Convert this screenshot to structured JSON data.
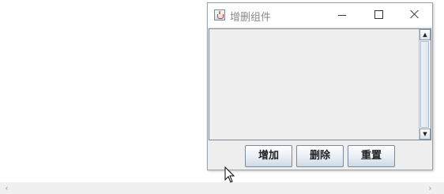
{
  "window": {
    "title": "增删组件",
    "icon": "java-cup-icon"
  },
  "buttons": {
    "add": "增加",
    "delete": "删除",
    "reset": "重置"
  },
  "scrollbar": {
    "up_glyph": "▲",
    "down_glyph": "▼",
    "left_glyph": "‹",
    "right_glyph": "›"
  }
}
